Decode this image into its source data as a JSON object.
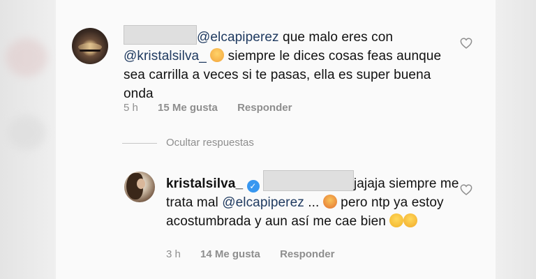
{
  "comment": {
    "mention_to": "@elcapiperez",
    "text_part1": " que malo eres con ",
    "mention_second": "@kristalsilva_",
    "text_part2": " siempre le dices cosas feas aunque sea carrilla a veces si te pasas, ella es super buena onda",
    "meta": {
      "time": "5 h",
      "likes": "15 Me gusta",
      "reply": "Responder"
    }
  },
  "hide_replies_label": "Ocultar respuestas",
  "reply": {
    "username": "kristalsilva_",
    "text_part1": "jajaja siempre me trata mal  ",
    "mention": "@elcapiperez",
    "text_part2": " ... ",
    "text_part3": " pero ntp ya estoy acostumbrada y aun así me cae bien ",
    "meta": {
      "time": "3 h",
      "likes": "14 Me gusta",
      "reply": "Responder"
    }
  },
  "colors": {
    "mention": "#1f3a60",
    "meta": "#8e8e8e",
    "verified": "#3897f0"
  },
  "icons": [
    "heart-outline-icon",
    "verified-badge-icon"
  ]
}
